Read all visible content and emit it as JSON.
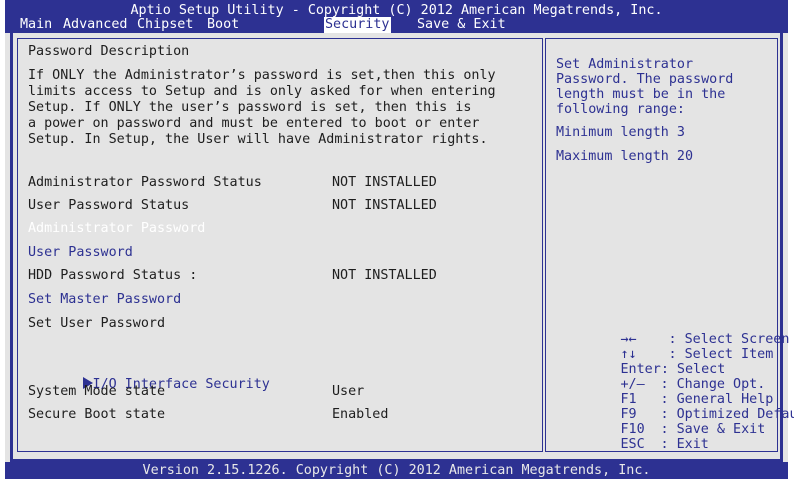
{
  "header": {
    "title": "Aptio Setup Utility - Copyright (C) 2012 American Megatrends, Inc.",
    "menu": [
      "Main",
      "Advanced",
      "Chipset",
      "Boot",
      "Security",
      "Save & Exit"
    ]
  },
  "left": {
    "section_title": "Password Description",
    "description": [
      "If ONLY the Administrator’s password is set,then this only",
      "limits access to Setup and is only asked for when entering",
      "Setup. If ONLY the user’s password is set, then this is",
      "a power on password and must be entered to boot or enter",
      "Setup. In Setup, the User will have Administrator rights."
    ],
    "admin_status_label": "Administrator Password Status",
    "admin_status_value": "NOT INSTALLED",
    "user_status_label": "User Password Status",
    "user_status_value": "NOT INSTALLED",
    "admin_password": "Administrator Password",
    "user_password": "User Password",
    "hdd_status_label": "HDD Password Status :",
    "hdd_status_value": "NOT INSTALLED",
    "set_master_password": "Set Master Password",
    "set_user_password": "Set User Password",
    "io_security": "I/O Interface Security",
    "system_mode_label": "System Mode state",
    "system_mode_value": "User",
    "secure_boot_label": "Secure Boot state",
    "secure_boot_value": "Enabled"
  },
  "right": {
    "description": [
      "Set Administrator",
      "Password. The password",
      "length must be in the",
      "following range:"
    ],
    "min_length": "Minimum length 3",
    "max_length": "Maximum length 20",
    "help": [
      {
        "key": "→←",
        "desc": ": Select Screen"
      },
      {
        "key": "↑↓",
        "desc": ": Select Item"
      },
      {
        "key": "Enter",
        "desc": ": Select"
      },
      {
        "key": "+/–",
        "desc": ": Change Opt."
      },
      {
        "key": "F1",
        "desc": ": General Help"
      },
      {
        "key": "F9",
        "desc": ": Optimized Defaults"
      },
      {
        "key": "F10",
        "desc": ": Save & Exit"
      },
      {
        "key": "ESC",
        "desc": ": Exit"
      }
    ]
  },
  "footer": {
    "version": "Version 2.15.1226. Copyright (C) 2012 American Megatrends, Inc."
  },
  "colors": {
    "bios_blue": "#2d3192",
    "panel_gray": "#e4e4e4",
    "highlight_text": "#ffffff"
  }
}
